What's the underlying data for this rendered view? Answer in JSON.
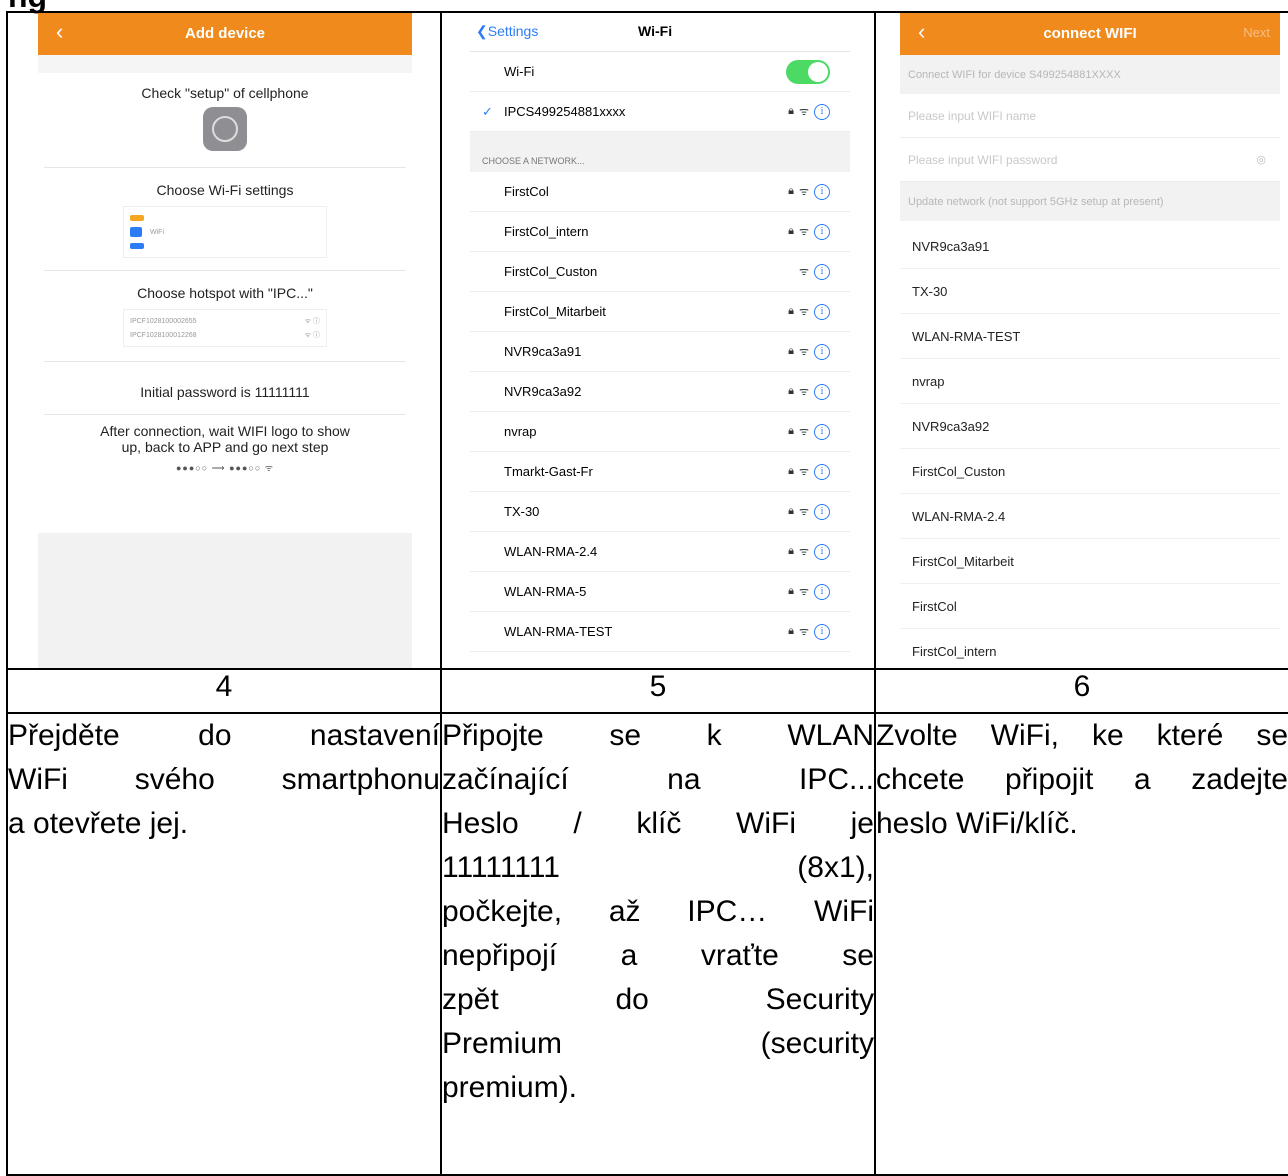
{
  "top_fragment": "ng",
  "screen1": {
    "title": "Add device",
    "back_glyph": "‹",
    "step1": "Check \"setup\" of cellphone",
    "step2": "Choose Wi-Fi settings",
    "mini_wifi_label": "WiFi",
    "step3": "Choose hotspot with \"IPC...\"",
    "mini_hotspot_1": "IPCF1028100002655",
    "mini_hotspot_2": "IPCF1028100012268",
    "step4": "Initial password is 11111111",
    "step5_line1": "After connection, wait WIFI logo to show",
    "step5_line2": "up, back to APP and go next step",
    "dots": "●●●○○   ⟶   ●●●○○ ᯤ"
  },
  "screen2": {
    "back_label": "❮Settings",
    "title": "Wi-Fi",
    "wifi_label": "Wi-Fi",
    "connected": "IPCS499254881xxxx",
    "group_label": "CHOOSE A NETWORK...",
    "networks": [
      {
        "name": "FirstCol",
        "lock": true
      },
      {
        "name": "FirstCol_intern",
        "lock": true
      },
      {
        "name": "FirstCol_Custon",
        "lock": false
      },
      {
        "name": "FirstCol_Mitarbeit",
        "lock": true
      },
      {
        "name": "NVR9ca3a91",
        "lock": true
      },
      {
        "name": "NVR9ca3a92",
        "lock": true
      },
      {
        "name": "nvrap",
        "lock": true
      },
      {
        "name": "Tmarkt-Gast-Fr",
        "lock": true
      },
      {
        "name": "TX-30",
        "lock": true
      },
      {
        "name": "WLAN-RMA-2.4",
        "lock": true
      },
      {
        "name": "WLAN-RMA-5",
        "lock": true
      },
      {
        "name": "WLAN-RMA-TEST",
        "lock": true
      }
    ]
  },
  "screen3": {
    "title": "connect WIFI",
    "next": "Next",
    "connect_for": "Connect WIFI for device S499254881XXXX",
    "name_placeholder": "Please input WIFI name",
    "password_placeholder": "Please input WIFI password",
    "update_note": "Update network (not support 5GHz setup at present)",
    "networks": [
      "NVR9ca3a91",
      "TX-30",
      "WLAN-RMA-TEST",
      "nvrap",
      "NVR9ca3a92",
      "FirstCol_Custon",
      "WLAN-RMA-2.4",
      "FirstCol_Mitarbeit",
      "FirstCol",
      "FirstCol_intern"
    ]
  },
  "steps": {
    "n4": "4",
    "n5": "5",
    "n6": "6"
  },
  "desc4": [
    "Přejděte do nastavení",
    "WiFi svého smartphonu",
    "a otevřete jej."
  ],
  "desc5": [
    "Připojte se k WLAN",
    "začínající na IPC...",
    "Heslo / klíč WiFi je",
    "11111111 (8x1),",
    "počkejte, až IPC… WiFi",
    "nepřipojí a vraťte se",
    "zpět do Security",
    "Premium (security",
    "premium)."
  ],
  "desc6": [
    "Zvolte WiFi, ke které se",
    "chcete připojit a zadejte",
    "heslo WiFi/klíč."
  ],
  "colors": {
    "orange": "#f08a1c",
    "ios_blue": "#2c7cf6",
    "toggle_green": "#4cd964"
  }
}
